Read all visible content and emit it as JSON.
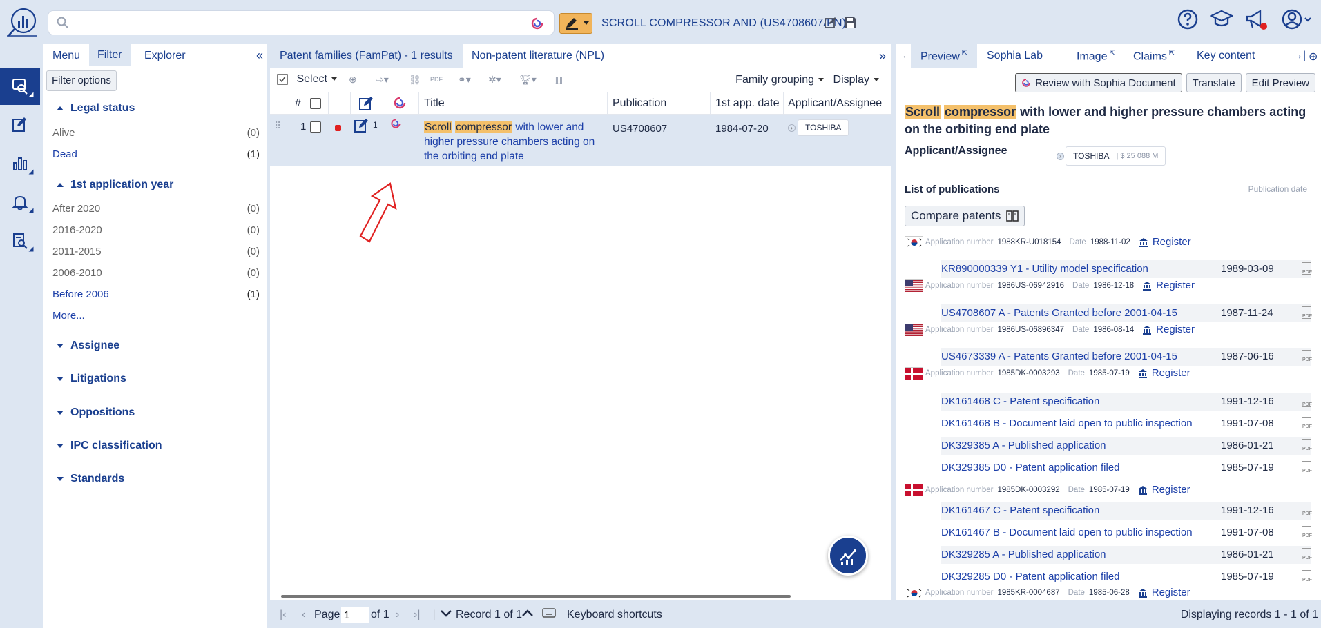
{
  "search": {
    "placeholder": ""
  },
  "query": {
    "text": "SCROLL COMPRESSOR AND (US4708607/PN)"
  },
  "icons": {
    "logo": "orbit-logo-icon",
    "search": "search-icon",
    "sophia": "sophia-icon",
    "help": "help-circle-icon",
    "learn": "graduation-cap-icon",
    "notify": "megaphone-icon",
    "user": "user-icon"
  },
  "left_panel": {
    "tabs": [
      "Menu",
      "Filter",
      "Explorer"
    ],
    "filter_options_label": "Filter options",
    "legal_status": {
      "title": "Legal status",
      "items": [
        {
          "label": "Alive",
          "count": "(0)"
        },
        {
          "label": "Dead",
          "count": "(1)"
        }
      ]
    },
    "first_app_year": {
      "title": "1st application year",
      "items": [
        {
          "label": "After 2020",
          "count": "(0)"
        },
        {
          "label": "2016-2020",
          "count": "(0)"
        },
        {
          "label": "2011-2015",
          "count": "(0)"
        },
        {
          "label": "2006-2010",
          "count": "(0)"
        },
        {
          "label": "Before 2006",
          "count": "(1)"
        }
      ],
      "more": "More..."
    },
    "collapsed_sections": [
      "Assignee",
      "Litigations",
      "Oppositions",
      "IPC classification",
      "Standards"
    ]
  },
  "center": {
    "tabs": [
      "Patent families (FamPat) - 1 results",
      "Non-patent literature (NPL)"
    ],
    "toolbar": {
      "select": "Select",
      "family_grouping": "Family grouping",
      "display": "Display"
    },
    "columns": [
      "#",
      "Title",
      "Publication",
      "1st app. date",
      "Applicant/Assignee"
    ],
    "row": {
      "index": "1",
      "count": "1",
      "title_hl1": "Scroll",
      "title_hl2": "compressor",
      "title_rest": " with lower and higher pressure chambers acting on the orbiting end plate",
      "publication": "US4708607",
      "app_date": "1984-07-20",
      "assignee": "TOSHIBA"
    }
  },
  "footer": {
    "page_label": "Page",
    "page_value": "1",
    "of_label": "of 1",
    "record_label": "Record 1 of 1",
    "shortcuts_label": "Keyboard shortcuts",
    "displaying": "Displaying records 1 - 1 of 1"
  },
  "right_panel": {
    "tabs": [
      "Preview",
      "Sophia Lab",
      "Image",
      "Claims",
      "Key content"
    ],
    "buttons": {
      "review": "Review with Sophia Document",
      "translate": "Translate",
      "edit": "Edit Preview"
    },
    "title_hl1": "Scroll",
    "title_hl2": "compressor",
    "title_rest": " with lower and higher pressure chambers acting on the orbiting end plate",
    "applicant_label": "Applicant/Assignee",
    "assignee": "TOSHIBA",
    "assignee_value": "| $ 25 088 M",
    "list_label": "List of publications",
    "pubdate_label": "Publication date",
    "compare": "Compare patents",
    "app_number_label": "Application number",
    "date_label": "Date",
    "register_label": "Register",
    "groups": [
      {
        "country": "KR",
        "app_no": "1988KR-U018154",
        "date": "1988-11-02",
        "pubs": [
          {
            "label": "KR890000339 Y1 - Utility model specification",
            "date": "1989-03-09"
          }
        ]
      },
      {
        "country": "US",
        "app_no": "1986US-06942916",
        "date": "1986-12-18",
        "pubs": [
          {
            "label": "US4708607 A - Patents Granted before 2001-04-15",
            "date": "1987-11-24"
          }
        ]
      },
      {
        "country": "US",
        "app_no": "1986US-06896347",
        "date": "1986-08-14",
        "pubs": [
          {
            "label": "US4673339 A - Patents Granted before 2001-04-15",
            "date": "1987-06-16"
          }
        ]
      },
      {
        "country": "DK",
        "app_no": "1985DK-0003293",
        "date": "1985-07-19",
        "pubs": [
          {
            "label": "DK161468 C - Patent specification",
            "date": "1991-12-16"
          },
          {
            "label": "DK161468 B - Document laid open to public inspection",
            "date": "1991-07-08"
          },
          {
            "label": "DK329385 A - Published application",
            "date": "1986-01-21"
          },
          {
            "label": "DK329385 D0 - Patent application filed",
            "date": "1985-07-19"
          }
        ]
      },
      {
        "country": "DK",
        "app_no": "1985DK-0003292",
        "date": "1985-07-19",
        "pubs": [
          {
            "label": "DK161467 C - Patent specification",
            "date": "1991-12-16"
          },
          {
            "label": "DK161467 B - Document laid open to public inspection",
            "date": "1991-07-08"
          },
          {
            "label": "DK329285 A - Published application",
            "date": "1986-01-21"
          },
          {
            "label": "DK329285 D0 - Patent application filed",
            "date": "1985-07-19"
          }
        ]
      },
      {
        "country": "KR",
        "app_no": "1985KR-0004687",
        "date": "1985-06-28",
        "pubs": []
      }
    ]
  },
  "colors": {
    "accent": "#1a3f8f",
    "link": "#1c3fa8",
    "highlight": "#f4c06a",
    "panel_bg": "#dde6f2",
    "alert": "#e02020"
  }
}
